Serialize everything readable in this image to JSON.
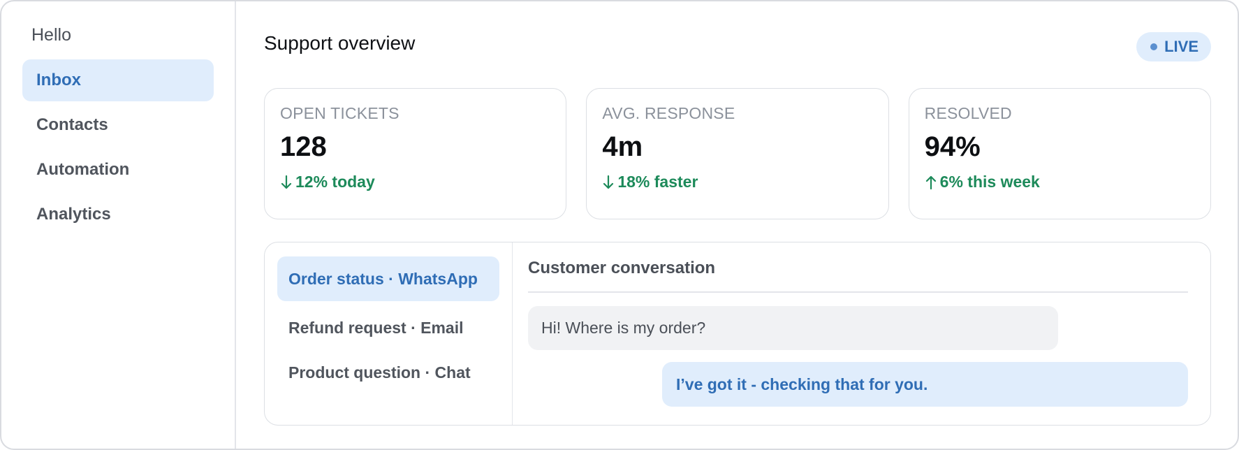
{
  "sidebar": {
    "brand": "Hello",
    "items": [
      {
        "label": "Inbox",
        "active": true
      },
      {
        "label": "Contacts",
        "active": false
      },
      {
        "label": "Automation",
        "active": false
      },
      {
        "label": "Analytics",
        "active": false
      }
    ]
  },
  "header": {
    "title": "Support overview",
    "live_badge": "LIVE"
  },
  "stats": [
    {
      "label": "OPEN TICKETS",
      "value": "128",
      "change": "12% today",
      "direction": "down"
    },
    {
      "label": "AVG. RESPONSE",
      "value": "4m",
      "change": "18% faster",
      "direction": "down"
    },
    {
      "label": "RESOLVED",
      "value": "94%",
      "change": "6% this week",
      "direction": "up"
    }
  ],
  "threads": [
    {
      "label": "Order status · WhatsApp",
      "active": true
    },
    {
      "label": "Refund request · Email",
      "active": false
    },
    {
      "label": "Product question · Chat",
      "active": false
    }
  ],
  "conversation": {
    "title": "Customer conversation",
    "incoming": "Hi! Where is my order?",
    "outgoing": "I’ve got it - checking that for you."
  },
  "colors": {
    "accent": "#2f6db5",
    "accent_bg": "#e0edfc",
    "positive": "#1d8a5a"
  },
  "icons": {
    "down": "arrow-down-icon",
    "up": "arrow-up-icon"
  }
}
